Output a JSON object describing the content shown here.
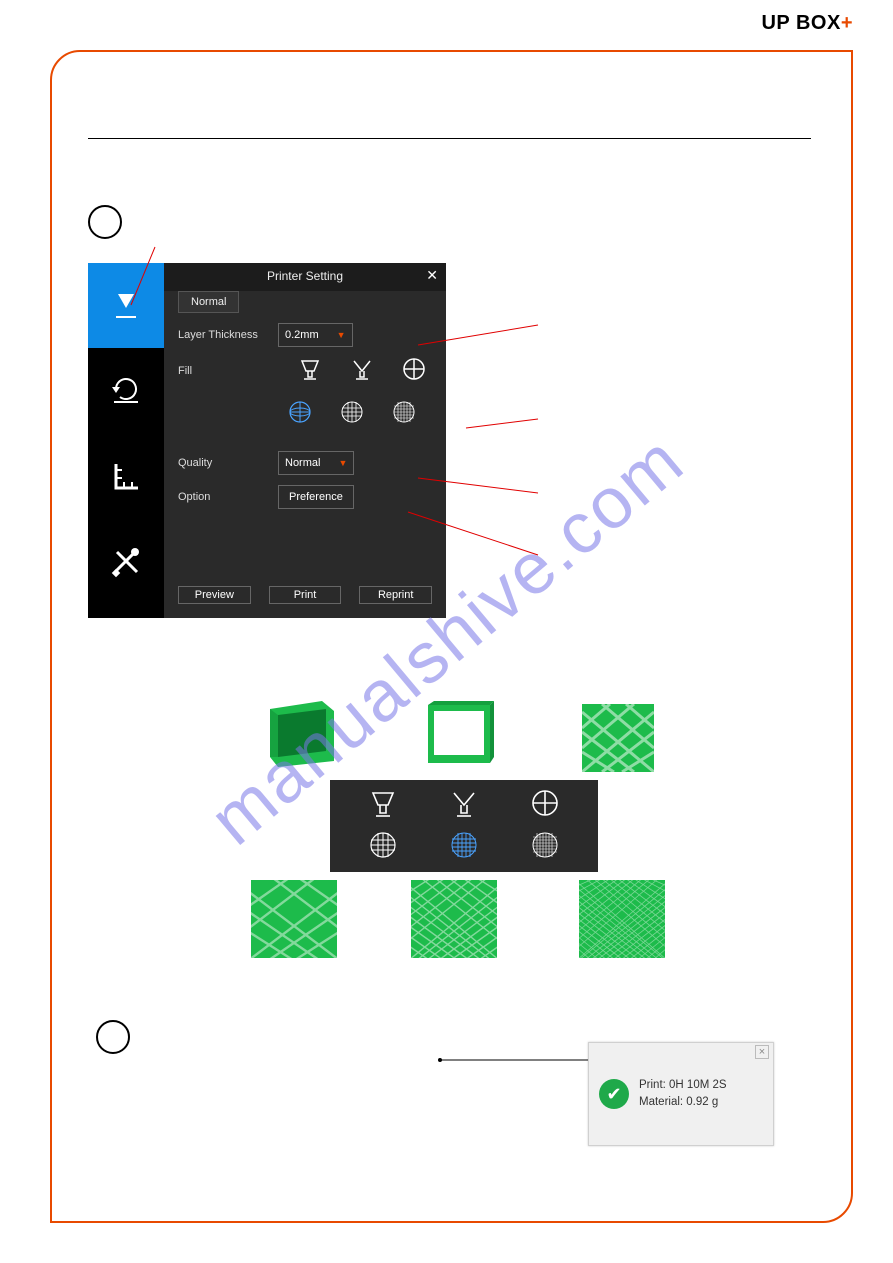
{
  "brand": {
    "prefix": "UP",
    "mid": "BOX",
    "plus": "+"
  },
  "dialog": {
    "title": "Printer Setting",
    "tab": "Normal",
    "labels": {
      "layer_thickness": "Layer Thickness",
      "fill": "Fill",
      "quality": "Quality",
      "option": "Option"
    },
    "layer_thickness_value": "0.2mm",
    "quality_value": "Normal",
    "option_button": "Preference",
    "buttons": {
      "preview": "Preview",
      "print": "Print",
      "reprint": "Reprint"
    },
    "fill_icons_row1": [
      "goblet",
      "martini",
      "quadrant"
    ],
    "fill_icons_row2": [
      "globe-sparse",
      "globe-medium",
      "globe-dense"
    ]
  },
  "strip_icons_row1": [
    "goblet",
    "martini",
    "quadrant"
  ],
  "strip_icons_row2": [
    "globe-sparse",
    "globe-medium",
    "globe-dense"
  ],
  "watermark": "manualshive.com",
  "notification": {
    "line1": "Print: 0H 10M 2S",
    "line2": "Material: 0.92 g"
  }
}
